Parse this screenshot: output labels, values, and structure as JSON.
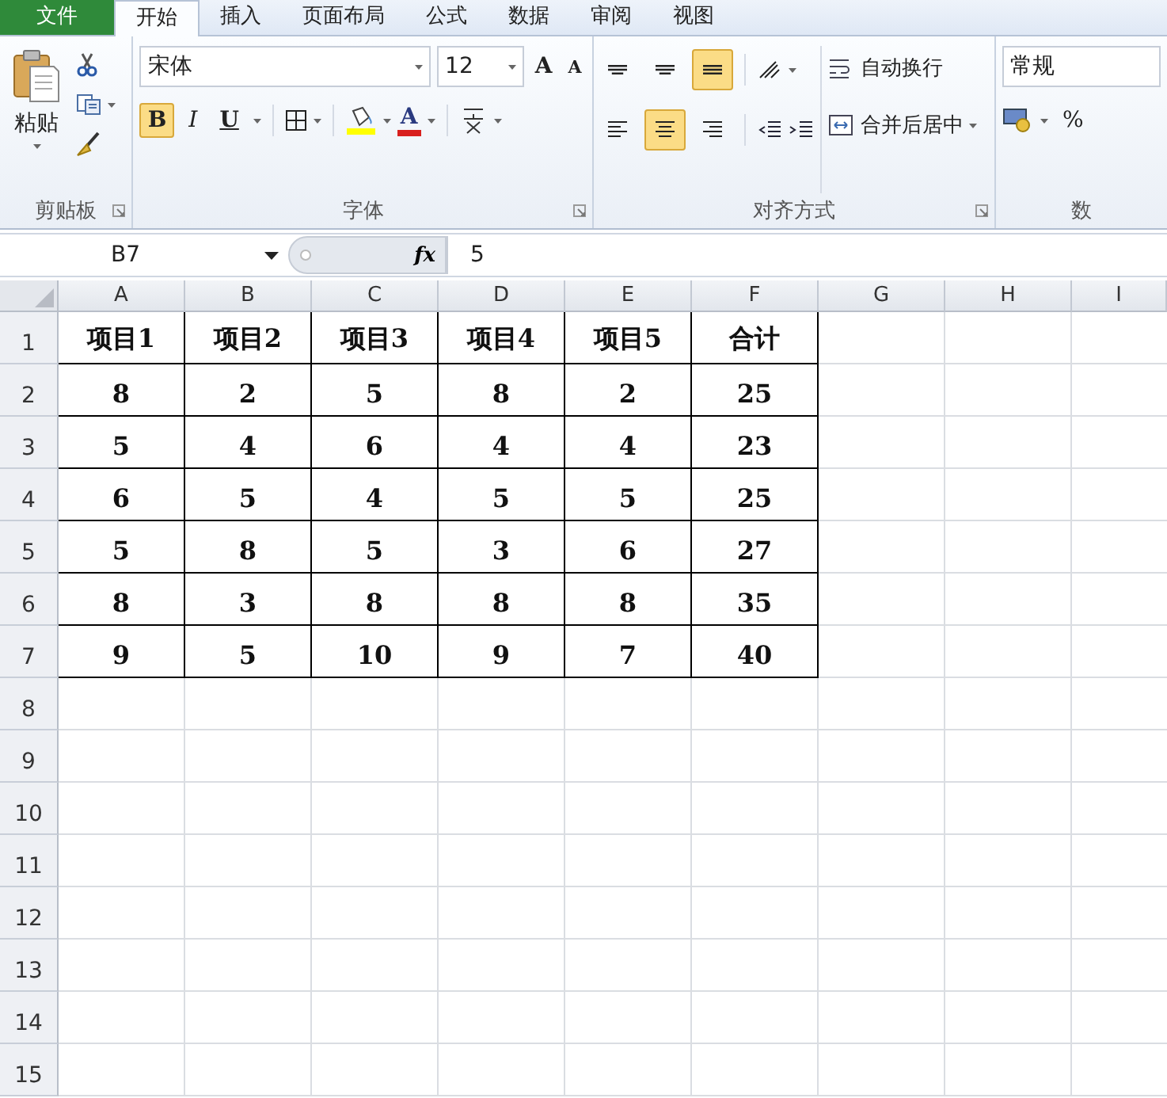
{
  "tabs": [
    {
      "label": "文件",
      "kind": "file",
      "selected": false
    },
    {
      "label": "开始",
      "kind": "tab",
      "selected": true
    },
    {
      "label": "插入",
      "kind": "tab",
      "selected": false
    },
    {
      "label": "页面布局",
      "kind": "tab",
      "selected": false
    },
    {
      "label": "公式",
      "kind": "tab",
      "selected": false
    },
    {
      "label": "数据",
      "kind": "tab",
      "selected": false
    },
    {
      "label": "审阅",
      "kind": "tab",
      "selected": false
    },
    {
      "label": "视图",
      "kind": "tab",
      "selected": false
    }
  ],
  "ribbon": {
    "clipboard": {
      "paste": "粘贴",
      "group_label": "剪贴板"
    },
    "font": {
      "name": "宋体",
      "size": "12",
      "grow": "A",
      "shrink": "A",
      "font_color": "A",
      "group_label": "字体",
      "styles": [
        {
          "kind": "bold",
          "label": "B",
          "on": true
        },
        {
          "kind": "italic",
          "label": "I",
          "on": false
        },
        {
          "kind": "underline",
          "label": "U",
          "on": false
        }
      ]
    },
    "alignment": {
      "vertical": [
        {
          "kind": "top",
          "on": false
        },
        {
          "kind": "middle",
          "on": false
        },
        {
          "kind": "bottom",
          "on": true
        }
      ],
      "horizontal": [
        {
          "kind": "left",
          "on": false
        },
        {
          "kind": "center",
          "on": true
        },
        {
          "kind": "right",
          "on": false
        }
      ],
      "wrap_text": "自动换行",
      "merge_center": "合并后居中",
      "group_label": "对齐方式"
    },
    "number": {
      "format": "常规",
      "percent": "%",
      "group_label": "数"
    }
  },
  "formula_bar": {
    "name_box": "B7",
    "function_label": "fx",
    "value": "5"
  },
  "sheet": {
    "columns": [
      "A",
      "B",
      "C",
      "D",
      "E",
      "F",
      "G",
      "H",
      "I"
    ],
    "rows": [
      {
        "header": "1",
        "cells": [
          "项目1",
          "项目2",
          "项目3",
          "项目4",
          "项目5",
          "合计"
        ]
      },
      {
        "header": "2",
        "cells": [
          "8",
          "2",
          "5",
          "8",
          "2",
          "25"
        ]
      },
      {
        "header": "3",
        "cells": [
          "5",
          "4",
          "6",
          "4",
          "4",
          "23"
        ]
      },
      {
        "header": "4",
        "cells": [
          "6",
          "5",
          "4",
          "5",
          "5",
          "25"
        ]
      },
      {
        "header": "5",
        "cells": [
          "5",
          "8",
          "5",
          "3",
          "6",
          "27"
        ]
      },
      {
        "header": "6",
        "cells": [
          "8",
          "3",
          "8",
          "8",
          "8",
          "35"
        ]
      },
      {
        "header": "7",
        "cells": [
          "9",
          "5",
          "10",
          "9",
          "7",
          "40"
        ]
      },
      {
        "header": "8"
      },
      {
        "header": "9"
      },
      {
        "header": "10"
      },
      {
        "header": "11"
      },
      {
        "header": "12"
      },
      {
        "header": "13"
      },
      {
        "header": "14"
      },
      {
        "header": "15"
      }
    ]
  }
}
